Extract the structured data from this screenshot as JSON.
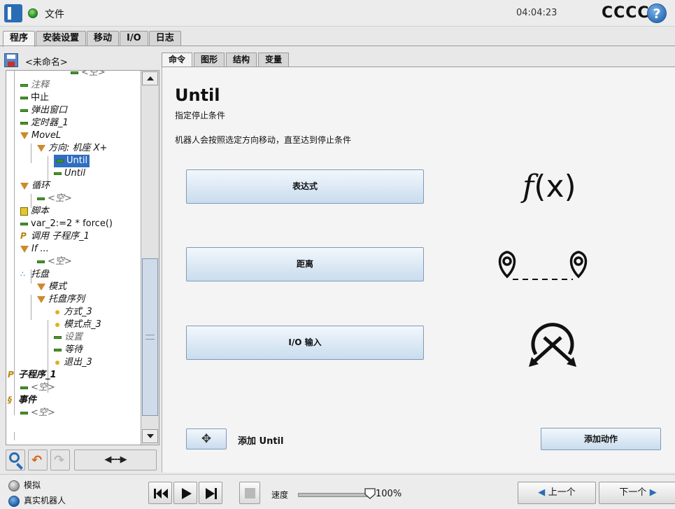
{
  "topbar": {
    "file_label": "文件",
    "clock": "04:04:23",
    "robot_name": "CCCC",
    "help_label": "?"
  },
  "main_tabs": [
    {
      "label": "程序",
      "active": true
    },
    {
      "label": "安装设置",
      "active": false
    },
    {
      "label": "移动",
      "active": false
    },
    {
      "label": "I/O",
      "active": false
    },
    {
      "label": "日志",
      "active": false
    }
  ],
  "program": {
    "name": "<未命名>"
  },
  "tree": [
    {
      "label": "<空>",
      "style": "gray",
      "icon": "dash-icon"
    },
    {
      "label": "注释",
      "style": "gray",
      "icon": "dash-icon"
    },
    {
      "label": "中止",
      "style": "normal",
      "icon": "dash-icon"
    },
    {
      "label": "弹出窗口",
      "style": "it",
      "icon": "dash-icon"
    },
    {
      "label": "定时器_1",
      "style": "it",
      "icon": "dash-icon"
    },
    {
      "label": "MoveL",
      "style": "it",
      "icon": "triangle-icon"
    },
    {
      "label": "方向: 机座 X+",
      "style": "it",
      "icon": "triangle-icon"
    },
    {
      "label": "Until",
      "style": "sel",
      "icon": "dash-icon"
    },
    {
      "label": "Until",
      "style": "it",
      "icon": "dash-icon"
    },
    {
      "label": "循环",
      "style": "it",
      "icon": "triangle-icon"
    },
    {
      "label": "<空>",
      "style": "gray",
      "icon": "dash-icon"
    },
    {
      "label": "脚本",
      "style": "it",
      "icon": "script-icon"
    },
    {
      "label": "var_2:=2 * force()",
      "style": "normal",
      "icon": "dash-icon"
    },
    {
      "label": "调用 子程序_1",
      "style": "it",
      "icon": "subprogram-icon"
    },
    {
      "label": "If ...",
      "style": "it",
      "icon": "triangle-icon"
    },
    {
      "label": "<空>",
      "style": "gray",
      "icon": "dash-icon"
    },
    {
      "label": "托盘",
      "style": "it",
      "icon": "pallet-icon"
    },
    {
      "label": "模式",
      "style": "it",
      "icon": "triangle-icon"
    },
    {
      "label": "托盘序列",
      "style": "it",
      "icon": "triangle-icon"
    },
    {
      "label": "方式_3",
      "style": "it",
      "icon": "waypoint-icon"
    },
    {
      "label": "模式点_3",
      "style": "it",
      "icon": "waypoint-icon"
    },
    {
      "label": "设置",
      "style": "gray",
      "icon": "dash-icon"
    },
    {
      "label": "等待",
      "style": "it",
      "icon": "dash-icon"
    },
    {
      "label": "退出_3",
      "style": "it",
      "icon": "waypoint-icon"
    },
    {
      "label": "子程序_1",
      "style": "bold",
      "icon": "subprogram-icon"
    },
    {
      "label": "<空>",
      "style": "gray",
      "icon": "dash-icon"
    },
    {
      "label": "事件",
      "style": "bold",
      "icon": "event-icon"
    },
    {
      "label": "<空>",
      "style": "gray",
      "icon": "dash-icon"
    }
  ],
  "left_tools": {
    "move_label": "◀---▶"
  },
  "sub_tabs": [
    {
      "label": "命令",
      "active": true
    },
    {
      "label": "图形",
      "active": false
    },
    {
      "label": "结构",
      "active": false
    },
    {
      "label": "变量",
      "active": false
    }
  ],
  "content": {
    "title": "Until",
    "subtitle": "指定停止条件",
    "description": "机器人会按照选定方向移动，直至达到停止条件",
    "expression_button": "表达式",
    "distance_button": "距离",
    "io_button": "I/O 输入",
    "fx_f": "f",
    "fx_rest": "(x)",
    "add_until_icon": "✥",
    "add_until_label": "添加 Until",
    "add_action_button": "添加动作"
  },
  "bottom": {
    "sim_label": "模拟",
    "real_label": "真实机器人",
    "speed_label": "速度",
    "speed_value": "100%",
    "speed_fraction": 1.0,
    "prev_label": "上一个",
    "next_label": "下一个"
  },
  "colors": {
    "accent": "#2a6db5",
    "selection": "#2f6ec0",
    "button_top": "#f2f7fc",
    "button_bottom": "#c9dcee"
  }
}
